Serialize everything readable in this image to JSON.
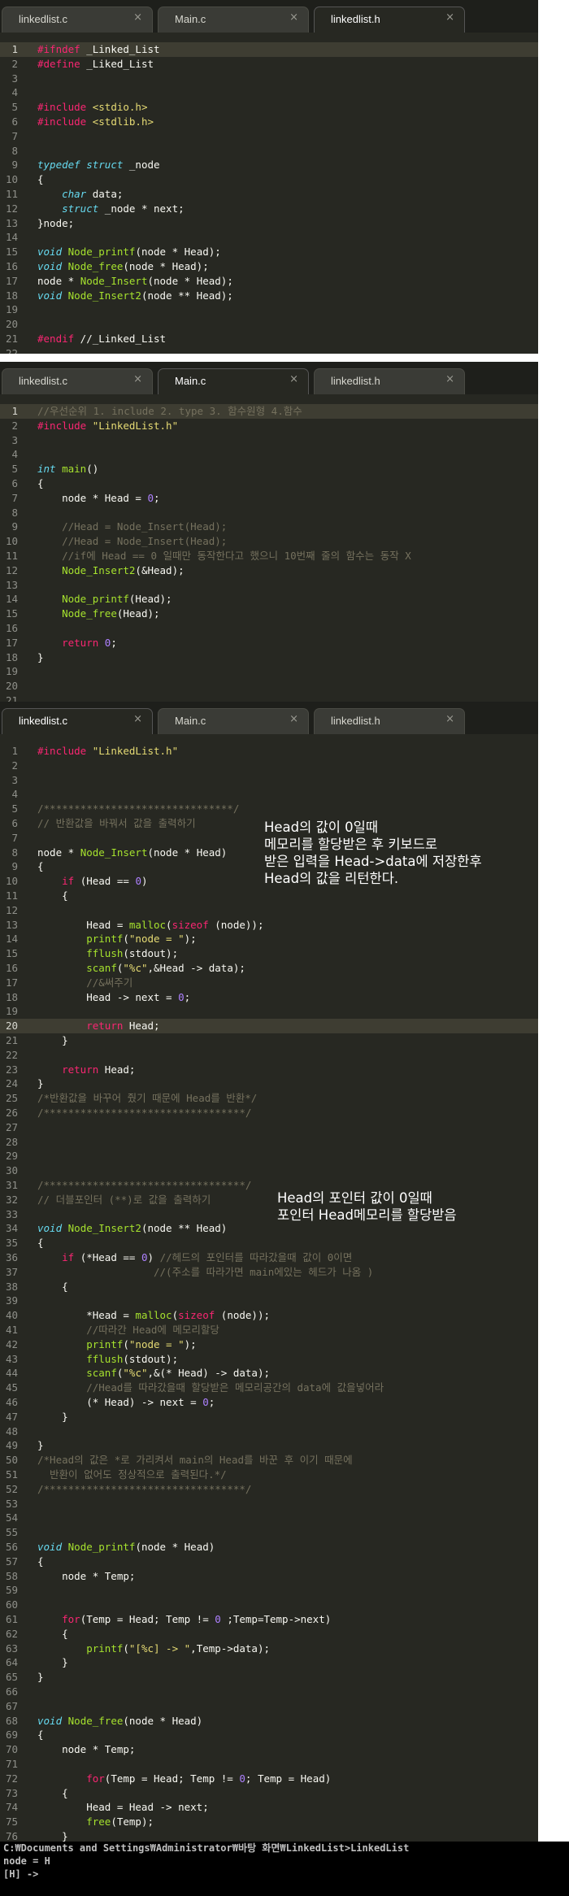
{
  "tabs": [
    {
      "label": "linkedlist.c",
      "close": "×"
    },
    {
      "label": "Main.c",
      "close": "×"
    },
    {
      "label": "linkedlist.h",
      "close": "×"
    }
  ],
  "panels": [
    {
      "active_tab": 2,
      "highlight_line": 1,
      "lines": [
        [
          [
            "k",
            "#ifndef"
          ],
          [
            "p",
            " _Linked_List"
          ]
        ],
        [
          [
            "k",
            "#define"
          ],
          [
            "p",
            " _Liked_List"
          ]
        ],
        [],
        [],
        [
          [
            "k",
            "#include"
          ],
          [
            "p",
            " "
          ],
          [
            "s",
            "<stdio.h>"
          ]
        ],
        [
          [
            "k",
            "#include"
          ],
          [
            "p",
            " "
          ],
          [
            "s",
            "<stdlib.h>"
          ]
        ],
        [],
        [],
        [
          [
            "t",
            "typedef"
          ],
          [
            "p",
            " "
          ],
          [
            "t",
            "struct"
          ],
          [
            "p",
            " _node"
          ]
        ],
        [
          [
            "p",
            "{"
          ]
        ],
        [
          [
            "p",
            "    "
          ],
          [
            "t",
            "char"
          ],
          [
            "p",
            " data;"
          ]
        ],
        [
          [
            "p",
            "    "
          ],
          [
            "t",
            "struct"
          ],
          [
            "p",
            " _node * next;"
          ]
        ],
        [
          [
            "p",
            "}node;"
          ]
        ],
        [],
        [
          [
            "t",
            "void"
          ],
          [
            "p",
            " "
          ],
          [
            "f",
            "Node_printf"
          ],
          [
            "p",
            "(node * Head);"
          ]
        ],
        [
          [
            "t",
            "void"
          ],
          [
            "p",
            " "
          ],
          [
            "f",
            "Node_free"
          ],
          [
            "p",
            "(node * Head);"
          ]
        ],
        [
          [
            "p",
            "node * "
          ],
          [
            "f",
            "Node_Insert"
          ],
          [
            "p",
            "(node * Head);"
          ]
        ],
        [
          [
            "t",
            "void"
          ],
          [
            "p",
            " "
          ],
          [
            "f",
            "Node_Insert2"
          ],
          [
            "p",
            "(node ** Head);"
          ]
        ],
        [],
        [],
        [
          [
            "k",
            "#endif"
          ],
          [
            "p",
            " //_Linked_List"
          ]
        ],
        []
      ]
    },
    {
      "active_tab": 1,
      "highlight_line": 1,
      "lines": [
        [
          [
            "c",
            "//우선순위 1. include 2. type 3. 함수원형 4.함수"
          ]
        ],
        [
          [
            "k",
            "#include"
          ],
          [
            "p",
            " "
          ],
          [
            "s",
            "\"LinkedList.h\""
          ]
        ],
        [],
        [],
        [
          [
            "t",
            "int"
          ],
          [
            "p",
            " "
          ],
          [
            "f",
            "main"
          ],
          [
            "p",
            "()"
          ]
        ],
        [
          [
            "p",
            "{"
          ]
        ],
        [
          [
            "p",
            "    node * Head = "
          ],
          [
            "n",
            "0"
          ],
          [
            "p",
            ";"
          ]
        ],
        [],
        [
          [
            "p",
            "    "
          ],
          [
            "c",
            "//Head = Node_Insert(Head);"
          ]
        ],
        [
          [
            "p",
            "    "
          ],
          [
            "c",
            "//Head = Node_Insert(Head);"
          ]
        ],
        [
          [
            "p",
            "    "
          ],
          [
            "c",
            "//if에 Head == 0 일때만 동작한다고 했으니 10번째 줄의 함수는 동작 X"
          ]
        ],
        [
          [
            "p",
            "    "
          ],
          [
            "f",
            "Node_Insert2"
          ],
          [
            "p",
            "(&Head);"
          ]
        ],
        [],
        [
          [
            "p",
            "    "
          ],
          [
            "f",
            "Node_printf"
          ],
          [
            "p",
            "(Head);"
          ]
        ],
        [
          [
            "p",
            "    "
          ],
          [
            "f",
            "Node_free"
          ],
          [
            "p",
            "(Head);"
          ]
        ],
        [],
        [
          [
            "p",
            "    "
          ],
          [
            "k",
            "return"
          ],
          [
            "p",
            " "
          ],
          [
            "n",
            "0"
          ],
          [
            "p",
            ";"
          ]
        ],
        [
          [
            "p",
            "}"
          ]
        ],
        [],
        [],
        []
      ]
    },
    {
      "active_tab": 0,
      "highlight_line": 20,
      "lines": [
        [
          [
            "k",
            "#include"
          ],
          [
            "p",
            " "
          ],
          [
            "s",
            "\"LinkedList.h\""
          ]
        ],
        [],
        [],
        [],
        [
          [
            "c",
            "/*******************************/"
          ]
        ],
        [
          [
            "c",
            "// 반환값을 바꿔서 값을 출력하기"
          ]
        ],
        [],
        [
          [
            "p",
            "node * "
          ],
          [
            "f",
            "Node_Insert"
          ],
          [
            "p",
            "(node * Head)"
          ]
        ],
        [
          [
            "p",
            "{"
          ]
        ],
        [
          [
            "p",
            "    "
          ],
          [
            "k",
            "if"
          ],
          [
            "p",
            " (Head == "
          ],
          [
            "n",
            "0"
          ],
          [
            "p",
            ")"
          ]
        ],
        [
          [
            "p",
            "    {"
          ]
        ],
        [],
        [
          [
            "p",
            "        Head = "
          ],
          [
            "f",
            "malloc"
          ],
          [
            "p",
            "("
          ],
          [
            "k",
            "sizeof"
          ],
          [
            "p",
            " (node));"
          ]
        ],
        [
          [
            "p",
            "        "
          ],
          [
            "f",
            "printf"
          ],
          [
            "p",
            "("
          ],
          [
            "s",
            "\"node = \""
          ],
          [
            "p",
            ");"
          ]
        ],
        [
          [
            "p",
            "        "
          ],
          [
            "f",
            "fflush"
          ],
          [
            "p",
            "(stdout);"
          ]
        ],
        [
          [
            "p",
            "        "
          ],
          [
            "f",
            "scanf"
          ],
          [
            "p",
            "("
          ],
          [
            "s",
            "\"%c\""
          ],
          [
            "p",
            ",&Head -> data);"
          ]
        ],
        [
          [
            "p",
            "        "
          ],
          [
            "c",
            "//&써주기"
          ]
        ],
        [
          [
            "p",
            "        Head -> next = "
          ],
          [
            "n",
            "0"
          ],
          [
            "p",
            ";"
          ]
        ],
        [],
        [
          [
            "p",
            "        "
          ],
          [
            "k",
            "return"
          ],
          [
            "p",
            " Head;"
          ]
        ],
        [
          [
            "p",
            "    }"
          ]
        ],
        [],
        [
          [
            "p",
            "    "
          ],
          [
            "k",
            "return"
          ],
          [
            "p",
            " Head;"
          ]
        ],
        [
          [
            "p",
            "}"
          ]
        ],
        [
          [
            "c",
            "/*반환값을 바꾸어 줬기 때문에 Head를 반환*/"
          ]
        ],
        [
          [
            "c",
            "/*********************************/"
          ]
        ],
        [],
        [],
        [],
        [],
        [
          [
            "c",
            "/*********************************/"
          ]
        ],
        [
          [
            "c",
            "// 더블포인터 (**)로 값을 출력하기"
          ]
        ],
        [],
        [
          [
            "t",
            "void"
          ],
          [
            "p",
            " "
          ],
          [
            "f",
            "Node_Insert2"
          ],
          [
            "p",
            "(node ** Head)"
          ]
        ],
        [
          [
            "p",
            "{"
          ]
        ],
        [
          [
            "p",
            "    "
          ],
          [
            "k",
            "if"
          ],
          [
            "p",
            " (*Head == "
          ],
          [
            "n",
            "0"
          ],
          [
            "p",
            ") "
          ],
          [
            "c",
            "//헤드의 포인터를 따라갔을때 값이 0이면"
          ]
        ],
        [
          [
            "p",
            "                   "
          ],
          [
            "c",
            "//(주소를 따라가면 main에있는 헤드가 나옴 )"
          ]
        ],
        [
          [
            "p",
            "    {"
          ]
        ],
        [],
        [
          [
            "p",
            "        *Head = "
          ],
          [
            "f",
            "malloc"
          ],
          [
            "p",
            "("
          ],
          [
            "k",
            "sizeof"
          ],
          [
            "p",
            " (node));"
          ]
        ],
        [
          [
            "p",
            "        "
          ],
          [
            "c",
            "//따라간 Head에 메모리할당"
          ]
        ],
        [
          [
            "p",
            "        "
          ],
          [
            "f",
            "printf"
          ],
          [
            "p",
            "("
          ],
          [
            "s",
            "\"node = \""
          ],
          [
            "p",
            ");"
          ]
        ],
        [
          [
            "p",
            "        "
          ],
          [
            "f",
            "fflush"
          ],
          [
            "p",
            "(stdout);"
          ]
        ],
        [
          [
            "p",
            "        "
          ],
          [
            "f",
            "scanf"
          ],
          [
            "p",
            "("
          ],
          [
            "s",
            "\"%c\""
          ],
          [
            "p",
            ",&(* Head) -> data);"
          ]
        ],
        [
          [
            "p",
            "        "
          ],
          [
            "c",
            "//Head를 따라갔을때 할당받은 메모리공간의 data에 값을넣어라"
          ]
        ],
        [
          [
            "p",
            "        (* Head) -> next = "
          ],
          [
            "n",
            "0"
          ],
          [
            "p",
            ";"
          ]
        ],
        [
          [
            "p",
            "    }"
          ]
        ],
        [],
        [
          [
            "p",
            "}"
          ]
        ],
        [
          [
            "c",
            "/*Head의 값은 *로 가리켜서 main의 Head를 바꾼 후 이기 때문에"
          ]
        ],
        [
          [
            "c",
            "  반환이 없어도 정상적으로 출력된다.*/"
          ]
        ],
        [
          [
            "c",
            "/*********************************/"
          ]
        ],
        [],
        [],
        [],
        [
          [
            "t",
            "void"
          ],
          [
            "p",
            " "
          ],
          [
            "f",
            "Node_printf"
          ],
          [
            "p",
            "(node * Head)"
          ]
        ],
        [
          [
            "p",
            "{"
          ]
        ],
        [
          [
            "p",
            "    node * Temp;"
          ]
        ],
        [],
        [],
        [
          [
            "p",
            "    "
          ],
          [
            "k",
            "for"
          ],
          [
            "p",
            "(Temp = Head; Temp != "
          ],
          [
            "n",
            "0"
          ],
          [
            "p",
            " ;Temp=Temp->next)"
          ]
        ],
        [
          [
            "p",
            "    {"
          ]
        ],
        [
          [
            "p",
            "        "
          ],
          [
            "f",
            "printf"
          ],
          [
            "p",
            "("
          ],
          [
            "s",
            "\"[%c] -> \""
          ],
          [
            "p",
            ",Temp->data);"
          ]
        ],
        [
          [
            "p",
            "    }"
          ]
        ],
        [
          [
            "p",
            "}"
          ]
        ],
        [],
        [],
        [
          [
            "t",
            "void"
          ],
          [
            "p",
            " "
          ],
          [
            "f",
            "Node_free"
          ],
          [
            "p",
            "(node * Head)"
          ]
        ],
        [
          [
            "p",
            "{"
          ]
        ],
        [
          [
            "p",
            "    node * Temp;"
          ]
        ],
        [],
        [
          [
            "p",
            "        "
          ],
          [
            "k",
            "for"
          ],
          [
            "p",
            "(Temp = Head; Temp != "
          ],
          [
            "n",
            "0"
          ],
          [
            "p",
            "; Temp = Head)"
          ]
        ],
        [
          [
            "p",
            "    {"
          ]
        ],
        [
          [
            "p",
            "        Head = Head -> next;"
          ]
        ],
        [
          [
            "p",
            "        "
          ],
          [
            "f",
            "free"
          ],
          [
            "p",
            "(Temp);"
          ]
        ],
        [
          [
            "p",
            "    }"
          ]
        ],
        [
          [
            "p",
            "}"
          ]
        ]
      ],
      "notes": [
        [
          "Head의 값이 0일때",
          "메모리를 할당받은 후 키보드로",
          "받은 입력을 Head->data에 저장한후",
          "Head의 값을 리턴한다."
        ],
        [
          "Head의 포인터 값이 0일때",
          "포인터 Head메모리를 할당받음"
        ]
      ]
    }
  ],
  "terminal": {
    "lines": [
      "C:₩Documents and Settings₩Administrator₩바탕 화면₩LinkedList>LinkedList",
      "node = H",
      "[H] ->"
    ]
  }
}
